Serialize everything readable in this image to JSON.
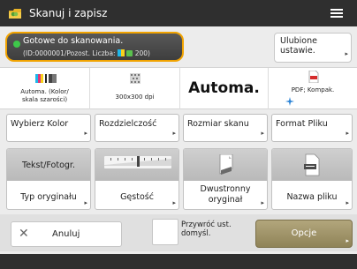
{
  "titlebar": {
    "title": "Skanuj i zapisz",
    "icon": "folder-icon",
    "menu_icon": "hamburger-menu-icon"
  },
  "status": {
    "message": "Gotowe do skanowania.",
    "details_prefix": "(ID:0000001/Pozost. Liczba:",
    "details_suffix": "200)"
  },
  "favorites": {
    "line1": "Ulubione",
    "line2": "ustawie."
  },
  "summary": {
    "color_line1": "Automa. (Kolor/",
    "color_line2": "skala szarości)",
    "resolution": "300x300 dpi",
    "size": "Automa.",
    "format": "PDF; Kompak."
  },
  "functions": [
    "Wybierz Kolor",
    "Rozdzielczość",
    "Rozmiar skanu",
    "Format Pliku"
  ],
  "options": {
    "original_type_value": "Tekst/Fotogr.",
    "original_type_label": "Typ oryginału",
    "density_label": "Gęstość",
    "duplex_line1": "Dwustronny",
    "duplex_line2": "oryginał",
    "filename_label": "Nazwa pliku"
  },
  "bottom": {
    "cancel_label": "Anuluj",
    "restore_line1": "Przywróć ust.",
    "restore_line2": "domyśl.",
    "options_label": "Opcje"
  },
  "colors": {
    "accent_border": "#f1a300",
    "ready_dot": "#3ec84a",
    "options_button": "#a0946a"
  }
}
